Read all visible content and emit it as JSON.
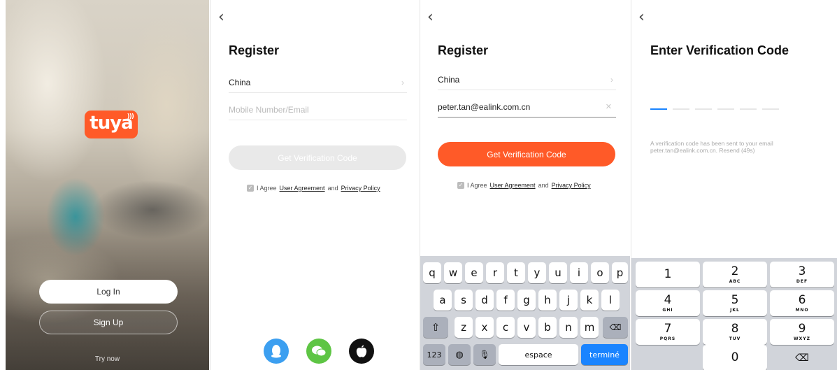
{
  "splash": {
    "logo_text": "tuya",
    "login_label": "Log In",
    "signup_label": "Sign Up",
    "try_now_label": "Try now"
  },
  "register": {
    "back_glyph": "‹",
    "title": "Register",
    "country": "China",
    "input_placeholder": "Mobile Number/Email",
    "button_label": "Get Verification Code",
    "agree_prefix": "I Agree",
    "user_agreement": "User Agreement",
    "and": "and",
    "privacy_policy": "Privacy Policy",
    "social_icons": [
      "qq-icon",
      "wechat-icon",
      "apple-icon"
    ]
  },
  "register_filled": {
    "title": "Register",
    "country": "China",
    "input_value": "peter.tan@ealink.com.cn",
    "button_label": "Get Verification Code",
    "agree_prefix": "I Agree",
    "user_agreement": "User Agreement",
    "and": "and",
    "privacy_policy": "Privacy Policy"
  },
  "keyboard": {
    "row1": [
      "q",
      "w",
      "e",
      "r",
      "t",
      "y",
      "u",
      "i",
      "o",
      "p"
    ],
    "row2": [
      "a",
      "s",
      "d",
      "f",
      "g",
      "h",
      "j",
      "k",
      "l"
    ],
    "row3": [
      "z",
      "x",
      "c",
      "v",
      "b",
      "n",
      "m"
    ],
    "numbers_key": "123",
    "space_key": "espace",
    "return_key": "terminé"
  },
  "verification": {
    "title": "Enter Verification Code",
    "message_line1": "A verification code has been sent to your email",
    "message_line2": "peter.tan@ealink.com.cn. Resend (49s)",
    "code_slot_count": 6,
    "numpad": [
      {
        "digit": "1",
        "letters": ""
      },
      {
        "digit": "2",
        "letters": "ABC"
      },
      {
        "digit": "3",
        "letters": "DEF"
      },
      {
        "digit": "4",
        "letters": "GHI"
      },
      {
        "digit": "5",
        "letters": "JKL"
      },
      {
        "digit": "6",
        "letters": "MNO"
      },
      {
        "digit": "7",
        "letters": "PQRS"
      },
      {
        "digit": "8",
        "letters": "TUV"
      },
      {
        "digit": "9",
        "letters": "WXYZ"
      },
      {
        "digit": "0",
        "letters": ""
      }
    ]
  },
  "colors": {
    "accent": "#ff5a28",
    "ios_blue": "#1a84ff",
    "disabled_button": "#e9e9e9",
    "qq": "#3c9ff0",
    "wechat": "#5ec544",
    "apple": "#111111"
  }
}
